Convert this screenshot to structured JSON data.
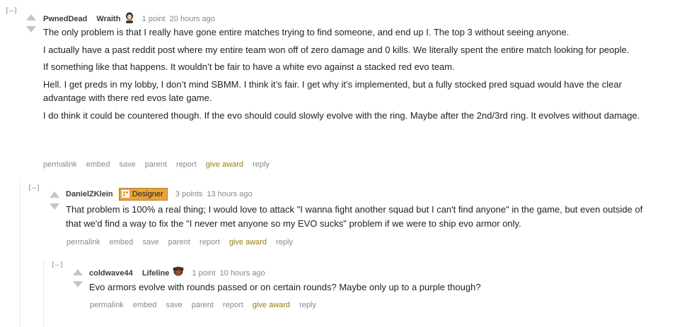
{
  "comments": [
    {
      "collapse": "[–]",
      "author": "PwnedDead",
      "flair": "Wraith",
      "flair_icon": "wraith-avatar-icon",
      "score": "1 point",
      "time": "20 hours ago",
      "paragraphs": [
        "The only problem is that I really have gone entire matches trying to find someone, and end up I. The top 3 without seeing anyone.",
        "I actually have a past reddit post where my entire team won off of zero damage and 0 kills. We literally spent the entire match looking for people.",
        "If something like that happens. It wouldn’t be fair to have a white evo against a stacked red evo team.",
        "Hell. I get preds in my lobby, I don’t mind SBMM. I think it’s fair. I get why it’s implemented, but a fully stocked pred squad would have the clear advantage with there red evos late game.",
        "I do think it could be countered though. If the evo should could slowly evolve with the ring. Maybe after the 2nd/3rd ring. It evolves without damage."
      ],
      "buttons": [
        "permalink",
        "embed",
        "save",
        "parent",
        "report",
        "give award",
        "reply"
      ]
    },
    {
      "collapse": "[–]",
      "author": "DanielZKlein",
      "badge": "Designer",
      "score": "3 points",
      "time": "13 hours ago",
      "paragraphs": [
        "That problem is 100% a real thing; I would love to attack \"I wanna fight another squad but I can't find anyone\" in the game, but even outside of that we'd find a way to fix the \"I never met anyone so my EVO sucks\" problem if we were to ship evo armor only."
      ],
      "buttons": [
        "permalink",
        "embed",
        "save",
        "parent",
        "report",
        "give award",
        "reply"
      ]
    },
    {
      "collapse": "[–]",
      "author": "coldwave44",
      "flair": "Lifeline",
      "flair_icon": "lifeline-avatar-icon",
      "score": "1 point",
      "time": "10 hours ago",
      "paragraphs": [
        "Evo armors evolve with rounds passed or on certain rounds? Maybe only up to a purple though?"
      ],
      "buttons": [
        "permalink",
        "embed",
        "save",
        "parent",
        "report",
        "give award",
        "reply"
      ]
    }
  ],
  "colors": {
    "award": "#9a7d0a",
    "designer_badge": "#e8a33a",
    "muted": "#888888",
    "arrow": "#c6c6c6"
  }
}
